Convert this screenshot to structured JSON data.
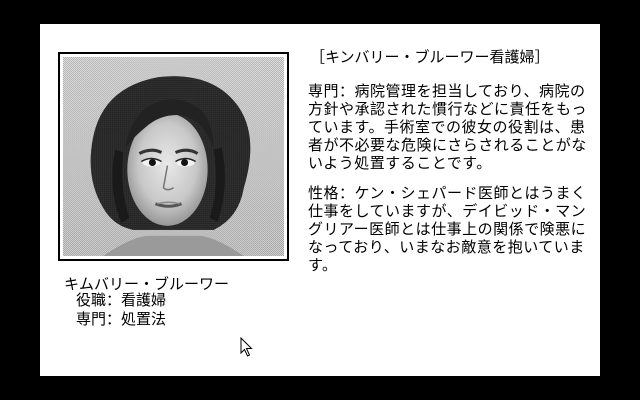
{
  "character": {
    "name": "キムバリー・ブルーワー",
    "role_label": "役職",
    "role_value": "看護婦",
    "specialty_label": "専門",
    "specialty_value": "処置法"
  },
  "profile": {
    "title": "［キンバリー・ブルーワー看護婦］",
    "specialty_text": "専門：病院管理を担当しており、病院の方針や承認された慣行などに責任をもっています。手術室での彼女の役割は、患者が不必要な危険にさらされることがないよう処置することです。",
    "personality_text": "性格：ケン・シェパード医師とはうまく仕事をしていますが、デイビッド・マングリアー医師とは仕事上の関係で険悪になっており、いまなお敵意を抱いています。"
  },
  "colors": {
    "background": "#000000",
    "panel": "#ffffff",
    "text": "#000000"
  }
}
